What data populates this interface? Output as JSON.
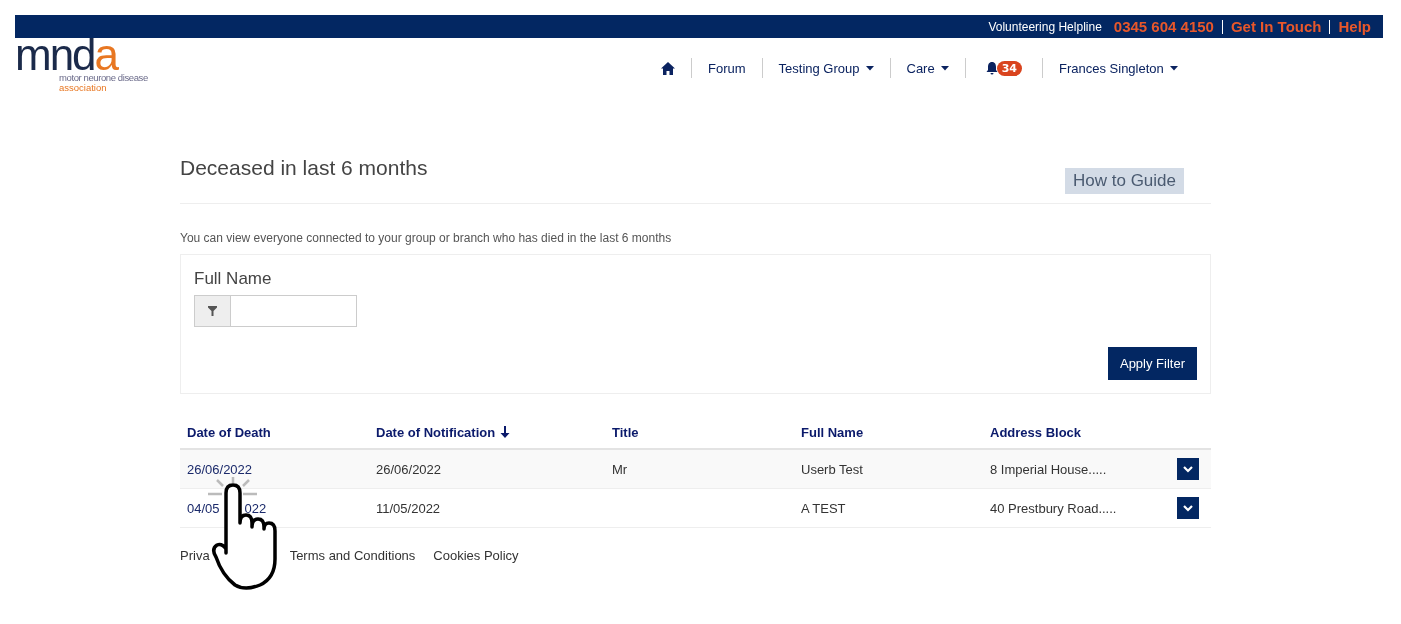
{
  "top_bar": {
    "helpline_label": "Volunteering Helpline",
    "phone": "0345 604 4150",
    "links": [
      "Get In Touch",
      "Help"
    ]
  },
  "logo": {
    "mark": "mnd",
    "mark_accent": "a",
    "line_1": "motor neurone disease",
    "line_2": "association"
  },
  "nav": [
    {
      "kind": "home"
    },
    {
      "kind": "link",
      "label": "Forum"
    },
    {
      "kind": "dropdown",
      "label": "Testing Group"
    },
    {
      "kind": "dropdown",
      "label": "Care"
    },
    {
      "kind": "bell",
      "badge": "34"
    },
    {
      "kind": "dropdown",
      "label": "Frances Singleton"
    }
  ],
  "page": {
    "title": "Deceased in last 6 months",
    "guide_button": "How to Guide",
    "intro": "You can view everyone connected to your group or branch who has died in the last 6 months"
  },
  "filter": {
    "label": "Full Name",
    "button": "Apply Filter"
  },
  "table": {
    "columns": [
      {
        "label": "Date of Death",
        "sorted": false
      },
      {
        "label": "Date of Notification",
        "sorted": true
      },
      {
        "label": "Title",
        "sorted": false
      },
      {
        "label": "Full Name",
        "sorted": false
      },
      {
        "label": "Address Block",
        "sorted": false
      }
    ],
    "rows": [
      {
        "cells": [
          [
            "26/06/2022"
          ],
          "26/06/2022",
          "Mr",
          "Userb Test",
          "8 Imperial House....."
        ]
      },
      {
        "cells": [
          [
            "04/05",
            "022"
          ],
          "11/05/2022",
          "",
          "A TEST",
          "40 Prestbury Road....."
        ]
      }
    ]
  },
  "footer": [
    "Priva",
    "Terms and Conditions",
    "Cookies Policy"
  ]
}
